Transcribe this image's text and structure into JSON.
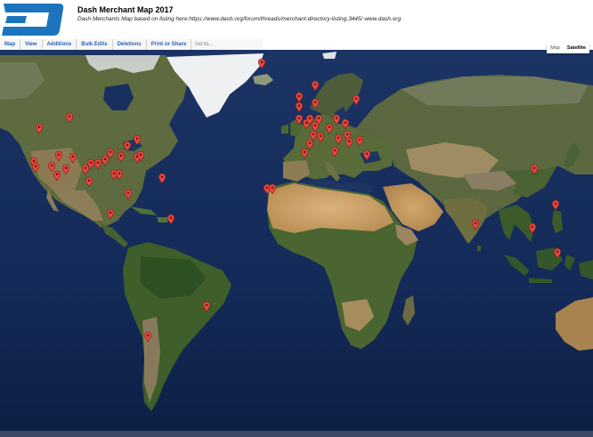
{
  "header": {
    "title": "Dash Merchant Map 2017",
    "subtitle": "Dash Merchants Map based on listing here:https://www.dash.org/forum/threads/merchant-directory-listing.3445/ www.dash.org"
  },
  "menu": {
    "items": [
      "Map",
      "View",
      "Additions",
      "Bulk Edits",
      "Deletions",
      "Print or Share"
    ],
    "goto_placeholder": "Go to..."
  },
  "map_type": {
    "options": [
      "Map",
      "Satellite"
    ],
    "selected": "Satellite"
  },
  "colors": {
    "brand": "#1c75bc",
    "marker": "#e8483f",
    "ocean": "#152a5c",
    "link": "#2a63b8"
  },
  "icons": {
    "logo": "dash-logo-icon",
    "marker": "map-pin-icon"
  }
}
